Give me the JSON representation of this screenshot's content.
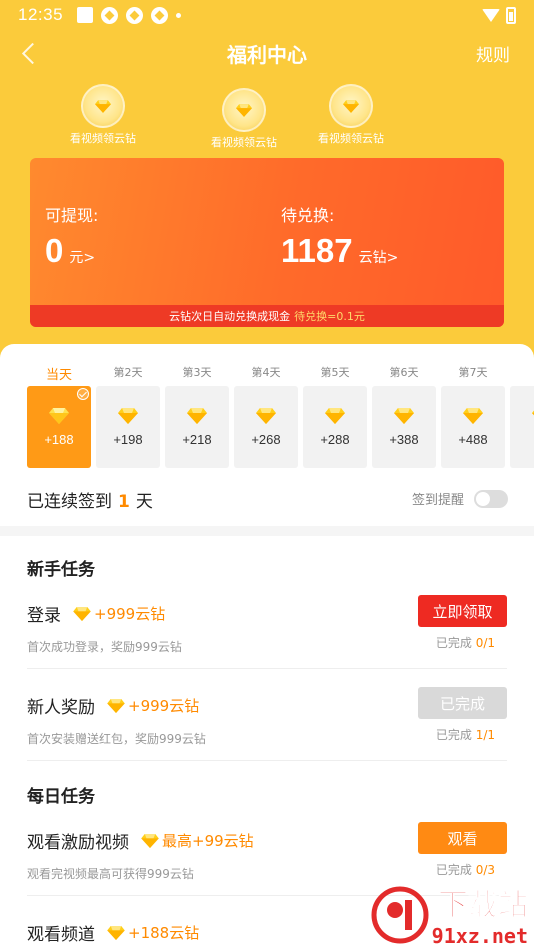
{
  "status_bar": {
    "time": "12:35"
  },
  "nav": {
    "title": "福利中心",
    "rules": "规则"
  },
  "bubbles": [
    {
      "label": "看视频领云钻"
    },
    {
      "label": "看视频领云钻"
    },
    {
      "label": "看视频领云钻"
    }
  ],
  "wallet": {
    "withdraw_label": "可提现:",
    "withdraw_amount": "0",
    "withdraw_unit": "元>",
    "pending_label": "待兑换:",
    "pending_amount": "1187",
    "pending_unit": "云钻>",
    "note": "云钻次日自动兑换成现金",
    "note_rate": "待兑换=0.1元"
  },
  "checkin": {
    "days": [
      {
        "label": "当天",
        "points": "+188"
      },
      {
        "label": "第2天",
        "points": "+198"
      },
      {
        "label": "第3天",
        "points": "+218"
      },
      {
        "label": "第4天",
        "points": "+268"
      },
      {
        "label": "第5天",
        "points": "+288"
      },
      {
        "label": "第6天",
        "points": "+388"
      },
      {
        "label": "第7天",
        "points": "+488"
      },
      {
        "label": "第",
        "points": "+"
      }
    ],
    "streak_prefix": "已连续签到",
    "streak_count": "1",
    "streak_suffix": "天",
    "reminder_label": "签到提醒"
  },
  "newbie": {
    "title": "新手任务",
    "tasks": [
      {
        "name": "登录",
        "reward": "+999云钻",
        "desc": "首次成功登录，奖励999云钻",
        "button": "立即领取",
        "progress_prefix": "已完成",
        "progress": "0/1"
      },
      {
        "name": "新人奖励",
        "reward": "+999云钻",
        "desc": "首次安装赠送红包，奖励999云钻",
        "button": "已完成",
        "progress_prefix": "已完成",
        "progress": "1/1"
      }
    ]
  },
  "daily": {
    "title": "每日任务",
    "tasks": [
      {
        "name": "观看激励视频",
        "reward": "最高+99云钻",
        "desc": "观看完视频最高可获得999云钻",
        "button": "观看",
        "progress_prefix": "已完成",
        "progress": "0/3"
      },
      {
        "name": "观看频道",
        "reward": "+188云钻"
      }
    ]
  },
  "watermark": {
    "title": "下载站",
    "sub": "91xz.net"
  }
}
